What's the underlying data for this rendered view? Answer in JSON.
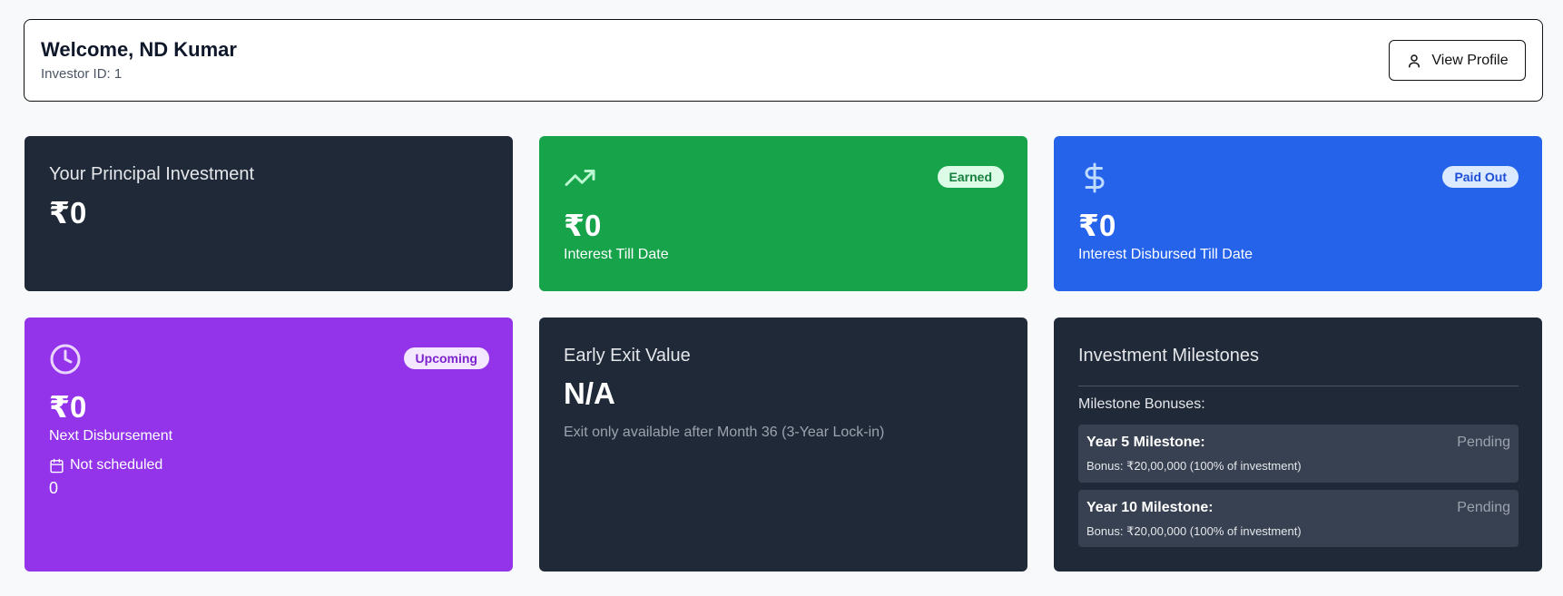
{
  "header": {
    "welcome": "Welcome, ND Kumar",
    "investor_id": "Investor ID: 1",
    "profile_button": "View Profile"
  },
  "cards": {
    "principal": {
      "title": "Your Principal Investment",
      "value": "₹0"
    },
    "interest": {
      "badge": "Earned",
      "value": "₹0",
      "label": "Interest Till Date",
      "icon": "trending-up-icon"
    },
    "disbursed": {
      "badge": "Paid Out",
      "value": "₹0",
      "label": "Interest Disbursed Till Date",
      "icon": "dollar-icon"
    },
    "next": {
      "badge": "Upcoming",
      "value": "₹0",
      "label": "Next Disbursement",
      "schedule": "Not scheduled",
      "count": "0",
      "icon": "clock-icon"
    },
    "exit": {
      "title": "Early Exit Value",
      "value": "N/A",
      "note": "Exit only available after Month 36 (3-Year Lock-in)"
    },
    "milestones": {
      "title": "Investment Milestones",
      "heading": "Milestone Bonuses:",
      "items": [
        {
          "title": "Year 5 Milestone:",
          "status": "Pending",
          "bonus": "Bonus: ₹20,00,000 (100% of investment)"
        },
        {
          "title": "Year 10 Milestone:",
          "status": "Pending",
          "bonus": "Bonus: ₹20,00,000 (100% of investment)"
        }
      ]
    }
  },
  "colors": {
    "dark": "#1f2937",
    "green": "#16a34a",
    "blue": "#2563eb",
    "purple": "#9333ea"
  }
}
